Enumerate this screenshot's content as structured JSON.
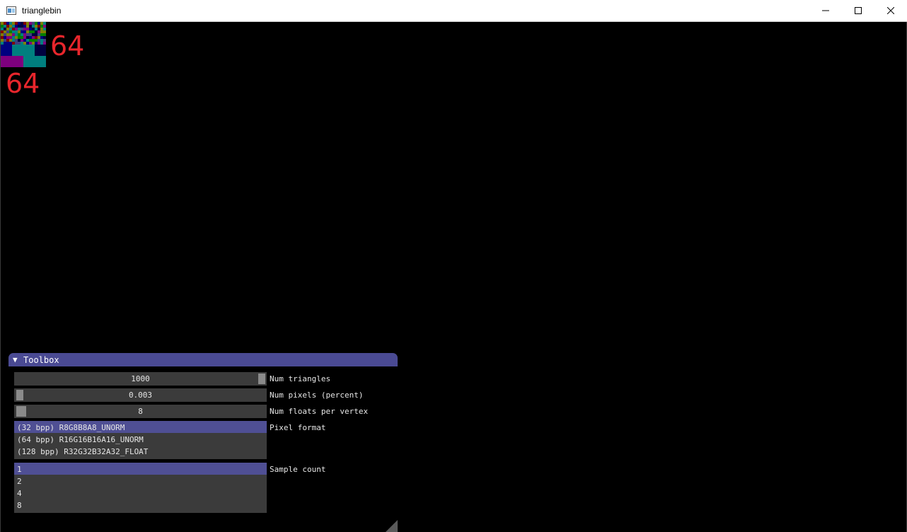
{
  "window": {
    "title": "trianglebin",
    "icons": {
      "app": "app-window-icon",
      "minimize": "minimize-icon",
      "maximize": "maximize-icon",
      "close": "close-icon"
    }
  },
  "bin_display": {
    "width_label": "64",
    "height_label": "64",
    "label_color": "#e8262c",
    "palette": [
      "#00007f",
      "#007f7f",
      "#7f007f",
      "#7f7f00",
      "#7f0000",
      "#007f00",
      "#3f3f7f",
      "#00003f"
    ]
  },
  "toolbox": {
    "title": "Toolbox",
    "header_color": "#4a4a93",
    "collapse_icon": "triangle-down-icon",
    "sliders": [
      {
        "value": "1000",
        "label": "Num triangles",
        "fraction": 1.0
      },
      {
        "value": "0.003",
        "label": "Num pixels (percent)",
        "fraction": 0.0
      },
      {
        "value": "8",
        "label": "Num floats per vertex",
        "fraction": 0.0
      }
    ],
    "pixel_format": {
      "label": "Pixel format",
      "options": [
        "(32 bpp) R8G8B8A8_UNORM",
        "(64 bpp) R16G16B16A16_UNORM",
        "(128 bpp) R32G32B32A32_FLOAT"
      ],
      "selected": 0
    },
    "sample_count": {
      "label": "Sample count",
      "options": [
        "1",
        "2",
        "4",
        "8"
      ],
      "selected": 0
    }
  }
}
